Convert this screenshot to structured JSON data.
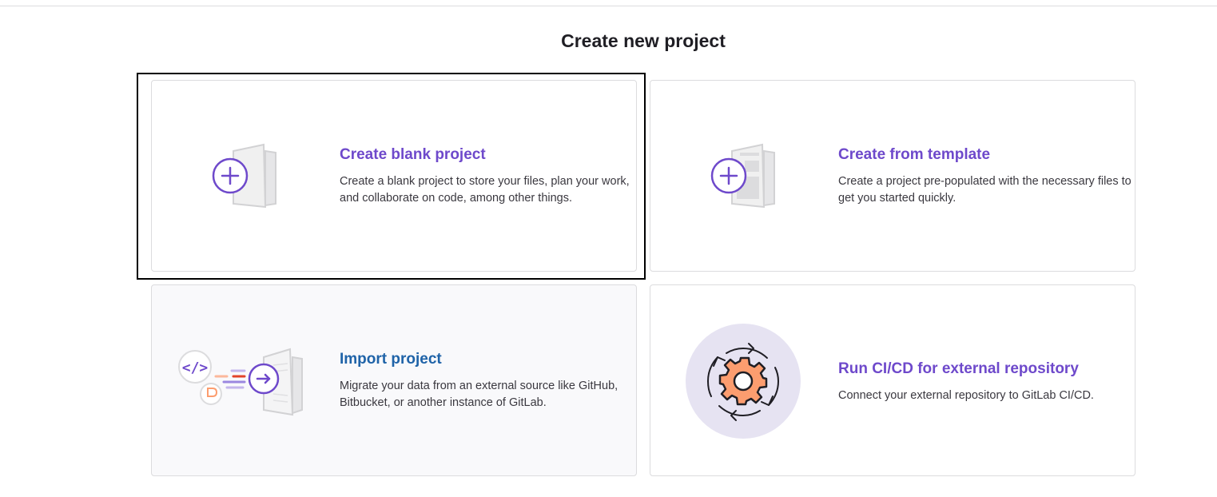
{
  "page": {
    "title": "Create new project"
  },
  "cards": [
    {
      "title": "Create blank project",
      "description": "Create a blank project to store your files, plan your work, and collaborate on code, among other things.",
      "icon": "blank-project-illustration"
    },
    {
      "title": "Create from template",
      "description": "Create a project pre-populated with the necessary files to get you started quickly.",
      "icon": "template-project-illustration"
    },
    {
      "title": "Import project",
      "description": "Migrate your data from an external source like GitHub, Bitbucket, or another instance of GitLab.",
      "icon": "import-project-illustration"
    },
    {
      "title": "Run CI/CD for external repository",
      "description": "Connect your external repository to GitLab CI/CD.",
      "icon": "cicd-gear-illustration"
    }
  ],
  "colors": {
    "purple": "#6e49cb",
    "blue": "#1f63a8",
    "orange": "#e24329",
    "gear_fill": "#fc9d6f",
    "card_border": "#dcdcde"
  }
}
